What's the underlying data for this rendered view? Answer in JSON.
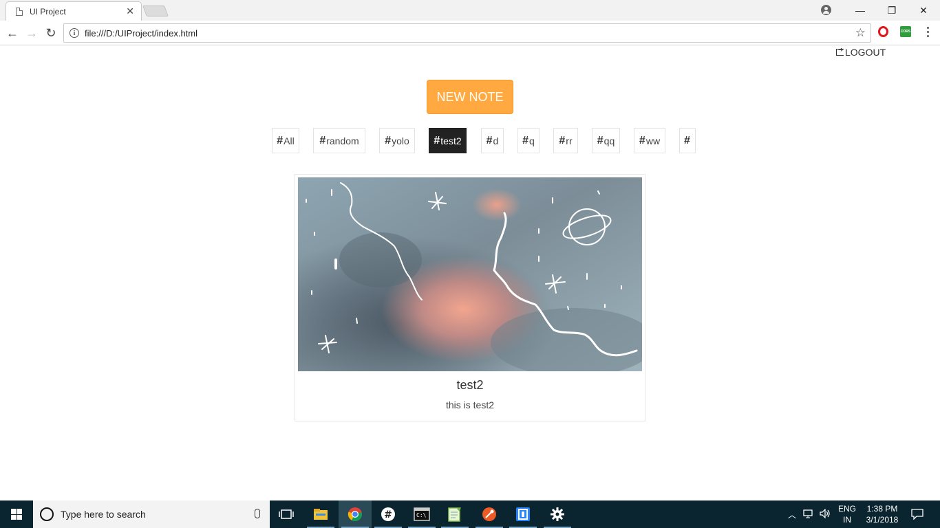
{
  "browser": {
    "tab_title": "UI Project",
    "tab_close": "✕",
    "url": "file:///D:/UIProject/index.html",
    "cors_label": "CORS",
    "window": {
      "minimize": "—",
      "maximize": "❐",
      "close": "✕"
    }
  },
  "page": {
    "logout_label": "LOGOUT",
    "new_note_label": "NEW NOTE",
    "tags": [
      {
        "label": "All",
        "active": false
      },
      {
        "label": "random",
        "active": false
      },
      {
        "label": "yolo",
        "active": false
      },
      {
        "label": "test2",
        "active": true
      },
      {
        "label": "d",
        "active": false
      },
      {
        "label": "q",
        "active": false
      },
      {
        "label": "rr",
        "active": false
      },
      {
        "label": "qq",
        "active": false
      },
      {
        "label": "ww",
        "active": false
      },
      {
        "label": "",
        "active": false
      }
    ],
    "tag_prefix": "#",
    "note": {
      "title": "test2",
      "body": "this is test2"
    }
  },
  "taskbar": {
    "search_placeholder": "Type here to search",
    "language_line1": "ENG",
    "language_line2": "IN",
    "time": "1:38 PM",
    "date": "3/1/2018",
    "apps": [
      "task-view",
      "file-explorer",
      "chrome",
      "slack",
      "terminal",
      "notepad-plus-plus",
      "postman",
      "sourcetree",
      "settings"
    ]
  },
  "colors": {
    "accent_orange": "#ffa940",
    "active_tag": "#222222",
    "taskbar": "#0b2530"
  }
}
